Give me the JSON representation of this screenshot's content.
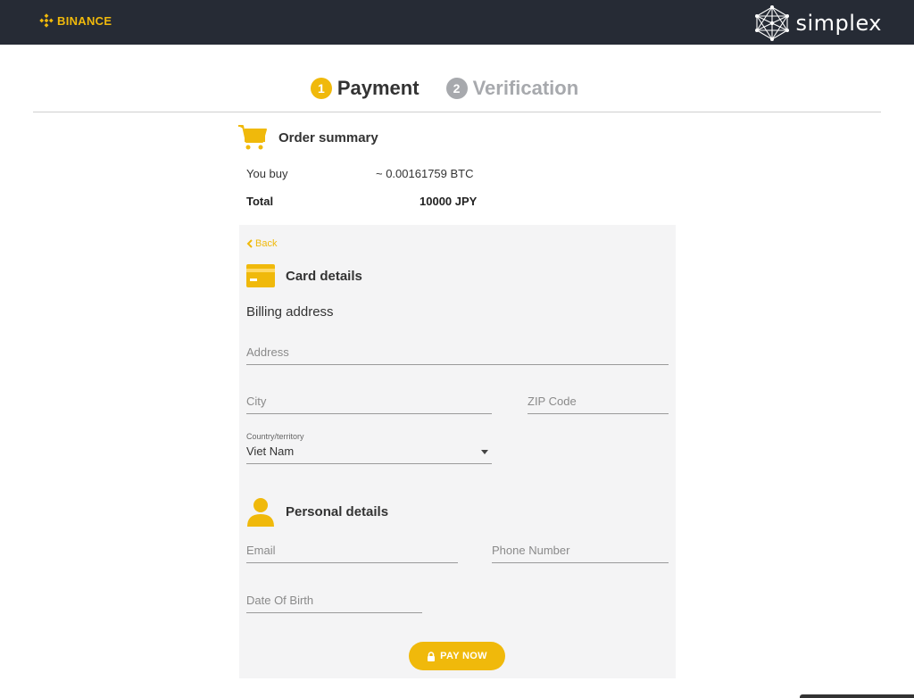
{
  "header": {
    "binance_logo_text": "BINANCE",
    "simplex_logo_text": "simplex",
    "brand_color": "#f0b90b",
    "bar_color": "#262b35"
  },
  "steps": [
    {
      "number": "1",
      "label": "Payment",
      "state": "active"
    },
    {
      "number": "2",
      "label": "Verification",
      "state": "inactive"
    }
  ],
  "order_summary": {
    "title": "Order summary",
    "icon": "cart-icon",
    "you_buy_label": "You buy",
    "you_buy_value": "~ 0.00161759 BTC",
    "total_label": "Total",
    "total_value": "10000 JPY"
  },
  "card_details": {
    "back_label": "Back",
    "title": "Card details",
    "icon": "card-icon",
    "billing_label": "Billing address",
    "address_placeholder": "Address",
    "city_placeholder": "City",
    "zip_placeholder": "ZIP Code",
    "country_label": "Country/territory",
    "country_value": "Viet Nam"
  },
  "personal_details": {
    "title": "Personal details",
    "icon": "person-icon",
    "email_placeholder": "Email",
    "phone_placeholder": "Phone Number",
    "dob_placeholder": "Date Of Birth"
  },
  "pay_button": {
    "label": "PAY NOW",
    "icon": "lock-icon"
  }
}
